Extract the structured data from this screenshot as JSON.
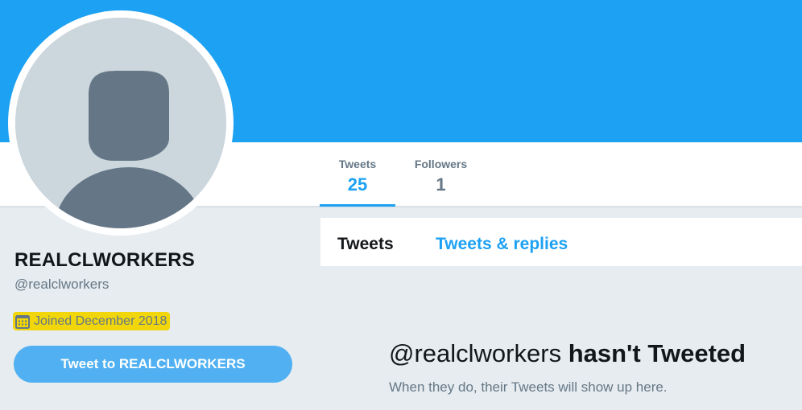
{
  "profile": {
    "name": "REALCLWORKERS",
    "handle": "@realclworkers",
    "joined": "Joined December 2018",
    "tweet_to_label": "Tweet to REALCLWORKERS"
  },
  "stats": [
    {
      "label": "Tweets",
      "value": "25",
      "active": true
    },
    {
      "label": "Followers",
      "value": "1",
      "active": false
    }
  ],
  "timeline_tabs": [
    {
      "label": "Tweets",
      "active": true
    },
    {
      "label": "Tweets & replies",
      "active": false
    }
  ],
  "empty_state": {
    "handle": "@realclworkers",
    "heading_rest": "hasn't Tweeted",
    "subtext": "When they do, their Tweets will show up here."
  },
  "colors": {
    "brand": "#1da1f2",
    "button": "#50b0f2",
    "highlight": "#f0d60a",
    "secondary_text": "#657786",
    "page_bg": "#e6ecf0"
  },
  "icons": {
    "joined": "calendar-icon",
    "avatar": "default-avatar-silhouette"
  }
}
